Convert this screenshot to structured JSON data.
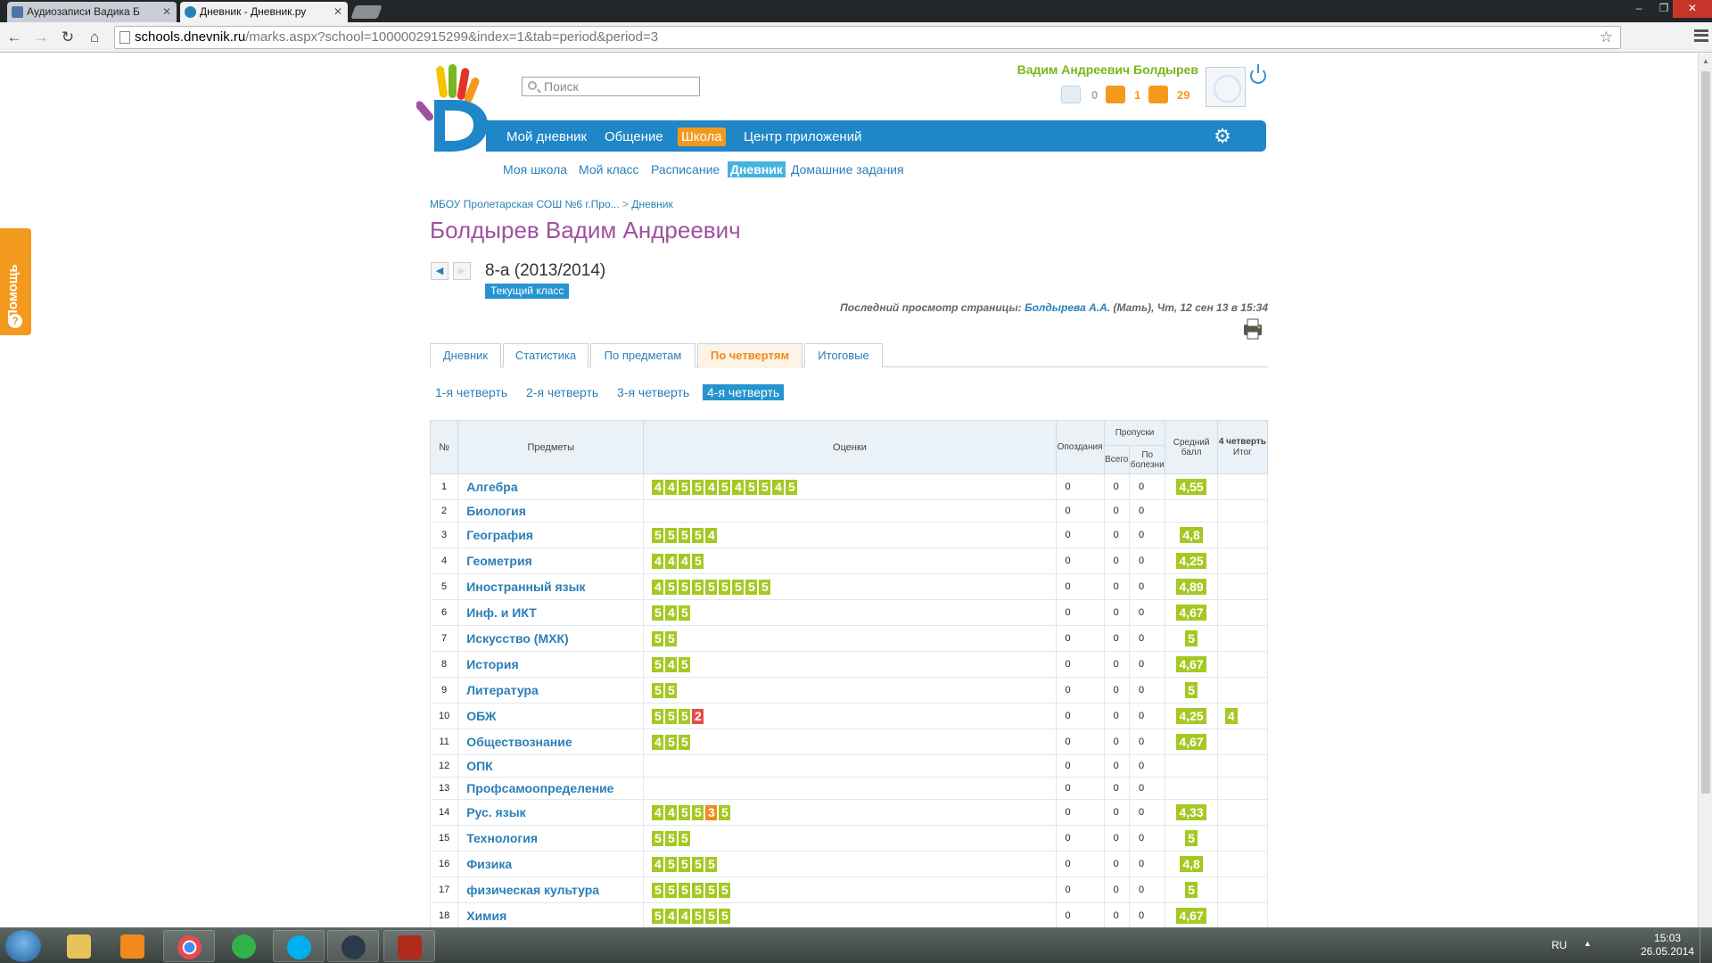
{
  "browser": {
    "tabs": [
      {
        "title": "Аудиозаписи Вадика Б",
        "active": false
      },
      {
        "title": "Дневник - Дневник.ру",
        "active": true
      }
    ],
    "url_host": "schools.dnevnik.ru",
    "url_path": "/marks.aspx?school=1000002915299&index=1&tab=period&period=3"
  },
  "help_label": "Помощь",
  "search_placeholder": "Поиск",
  "user": {
    "name": "Вадим Андреевич Болдырев",
    "messages": "0",
    "friends": "1",
    "groups": "29"
  },
  "main_nav": [
    {
      "label": "Мой дневник",
      "active": false
    },
    {
      "label": "Общение",
      "active": false
    },
    {
      "label": "Школа",
      "active": true
    },
    {
      "label": "Центр приложений",
      "active": false
    }
  ],
  "sub_nav": [
    {
      "label": "Моя школа",
      "active": false
    },
    {
      "label": "Мой класс",
      "active": false
    },
    {
      "label": "Расписание",
      "active": false
    },
    {
      "label": "Дневник",
      "active": true
    },
    {
      "label": "Домашние задания",
      "active": false
    }
  ],
  "breadcrumb": {
    "school": "МБОУ Пролетарская СОШ №6 г.Про...",
    "sep": ">",
    "current": "Дневник"
  },
  "page_title": "Болдырев Вадим Андреевич",
  "class_name": "8-а (2013/2014)",
  "current_class_label": "Текущий класс",
  "last_view": {
    "prefix": "Последний просмотр страницы:",
    "who": "Болдырева А.А.",
    "details": "(Мать), Чт, 12 сен 13 в 15:34"
  },
  "tabs": [
    {
      "label": "Дневник",
      "active": false
    },
    {
      "label": "Статистика",
      "active": false
    },
    {
      "label": "По предметам",
      "active": false
    },
    {
      "label": "По четвертям",
      "active": true
    },
    {
      "label": "Итоговые",
      "active": false
    }
  ],
  "quarters": [
    {
      "label": "1-я четверть",
      "active": false
    },
    {
      "label": "2-я четверть",
      "active": false
    },
    {
      "label": "3-я четверть",
      "active": false
    },
    {
      "label": "4-я четверть",
      "active": true
    }
  ],
  "table_headers": {
    "num": "№",
    "subject": "Предметы",
    "marks": "Оценки",
    "late": "Опоздания",
    "absences": "Пропуски",
    "total": "Всего",
    "sick": "По болезни",
    "avg": "Средний балл",
    "final_q": "4 четверть",
    "final": "Итог"
  },
  "rows": [
    {
      "n": "1",
      "subject": "Алгебра",
      "marks": [
        "4",
        "4",
        "5",
        "5",
        "4",
        "5",
        "4",
        "5",
        "5",
        "4",
        "5"
      ],
      "late": "0",
      "total": "0",
      "sick": "0",
      "avg": "4,55",
      "final": ""
    },
    {
      "n": "2",
      "subject": "Биология",
      "marks": [],
      "late": "0",
      "total": "0",
      "sick": "0",
      "avg": "",
      "final": ""
    },
    {
      "n": "3",
      "subject": "География",
      "marks": [
        "5",
        "5",
        "5",
        "5",
        "4"
      ],
      "late": "0",
      "total": "0",
      "sick": "0",
      "avg": "4,8",
      "final": ""
    },
    {
      "n": "4",
      "subject": "Геометрия",
      "marks": [
        "4",
        "4",
        "4",
        "5"
      ],
      "late": "0",
      "total": "0",
      "sick": "0",
      "avg": "4,25",
      "final": ""
    },
    {
      "n": "5",
      "subject": "Иностранный язык",
      "marks": [
        "4",
        "5",
        "5",
        "5",
        "5",
        "5",
        "5",
        "5",
        "5"
      ],
      "late": "0",
      "total": "0",
      "sick": "0",
      "avg": "4,89",
      "final": ""
    },
    {
      "n": "6",
      "subject": "Инф. и ИКТ",
      "marks": [
        "5",
        "4",
        "5"
      ],
      "late": "0",
      "total": "0",
      "sick": "0",
      "avg": "4,67",
      "final": ""
    },
    {
      "n": "7",
      "subject": "Искусство (МХК)",
      "marks": [
        "5",
        "5"
      ],
      "late": "0",
      "total": "0",
      "sick": "0",
      "avg": "5",
      "final": ""
    },
    {
      "n": "8",
      "subject": "История",
      "marks": [
        "5",
        "4",
        "5"
      ],
      "late": "0",
      "total": "0",
      "sick": "0",
      "avg": "4,67",
      "final": ""
    },
    {
      "n": "9",
      "subject": "Литература",
      "marks": [
        "5",
        "5"
      ],
      "late": "0",
      "total": "0",
      "sick": "0",
      "avg": "5",
      "final": ""
    },
    {
      "n": "10",
      "subject": "ОБЖ",
      "marks": [
        "5",
        "5",
        "5",
        "2"
      ],
      "late": "0",
      "total": "0",
      "sick": "0",
      "avg": "4,25",
      "final": "4"
    },
    {
      "n": "11",
      "subject": "Обществознание",
      "marks": [
        "4",
        "5",
        "5"
      ],
      "late": "0",
      "total": "0",
      "sick": "0",
      "avg": "4,67",
      "final": ""
    },
    {
      "n": "12",
      "subject": "ОПК",
      "marks": [],
      "late": "0",
      "total": "0",
      "sick": "0",
      "avg": "",
      "final": ""
    },
    {
      "n": "13",
      "subject": "Профсамоопределение",
      "marks": [],
      "late": "0",
      "total": "0",
      "sick": "0",
      "avg": "",
      "final": ""
    },
    {
      "n": "14",
      "subject": "Рус. язык",
      "marks": [
        "4",
        "4",
        "5",
        "5",
        "3",
        "5"
      ],
      "late": "0",
      "total": "0",
      "sick": "0",
      "avg": "4,33",
      "final": ""
    },
    {
      "n": "15",
      "subject": "Технология",
      "marks": [
        "5",
        "5",
        "5"
      ],
      "late": "0",
      "total": "0",
      "sick": "0",
      "avg": "5",
      "final": ""
    },
    {
      "n": "16",
      "subject": "Физика",
      "marks": [
        "4",
        "5",
        "5",
        "5",
        "5"
      ],
      "late": "0",
      "total": "0",
      "sick": "0",
      "avg": "4,8",
      "final": ""
    },
    {
      "n": "17",
      "subject": "физическая культура",
      "marks": [
        "5",
        "5",
        "5",
        "5",
        "5",
        "5"
      ],
      "late": "0",
      "total": "0",
      "sick": "0",
      "avg": "5",
      "final": ""
    },
    {
      "n": "18",
      "subject": "Химия",
      "marks": [
        "5",
        "4",
        "4",
        "5",
        "5",
        "5"
      ],
      "late": "0",
      "total": "0",
      "sick": "0",
      "avg": "4,67",
      "final": ""
    }
  ],
  "taskbar": {
    "lang": "RU",
    "time": "15:03",
    "date": "26.05.2014"
  },
  "colors": {
    "brand_blue": "#1f86c7",
    "accent_orange": "#f39a1e",
    "mark_green": "#a5c822",
    "mark_red": "#e64c4c",
    "mark_orange": "#f08a1c",
    "title_purple": "#a0519e"
  }
}
